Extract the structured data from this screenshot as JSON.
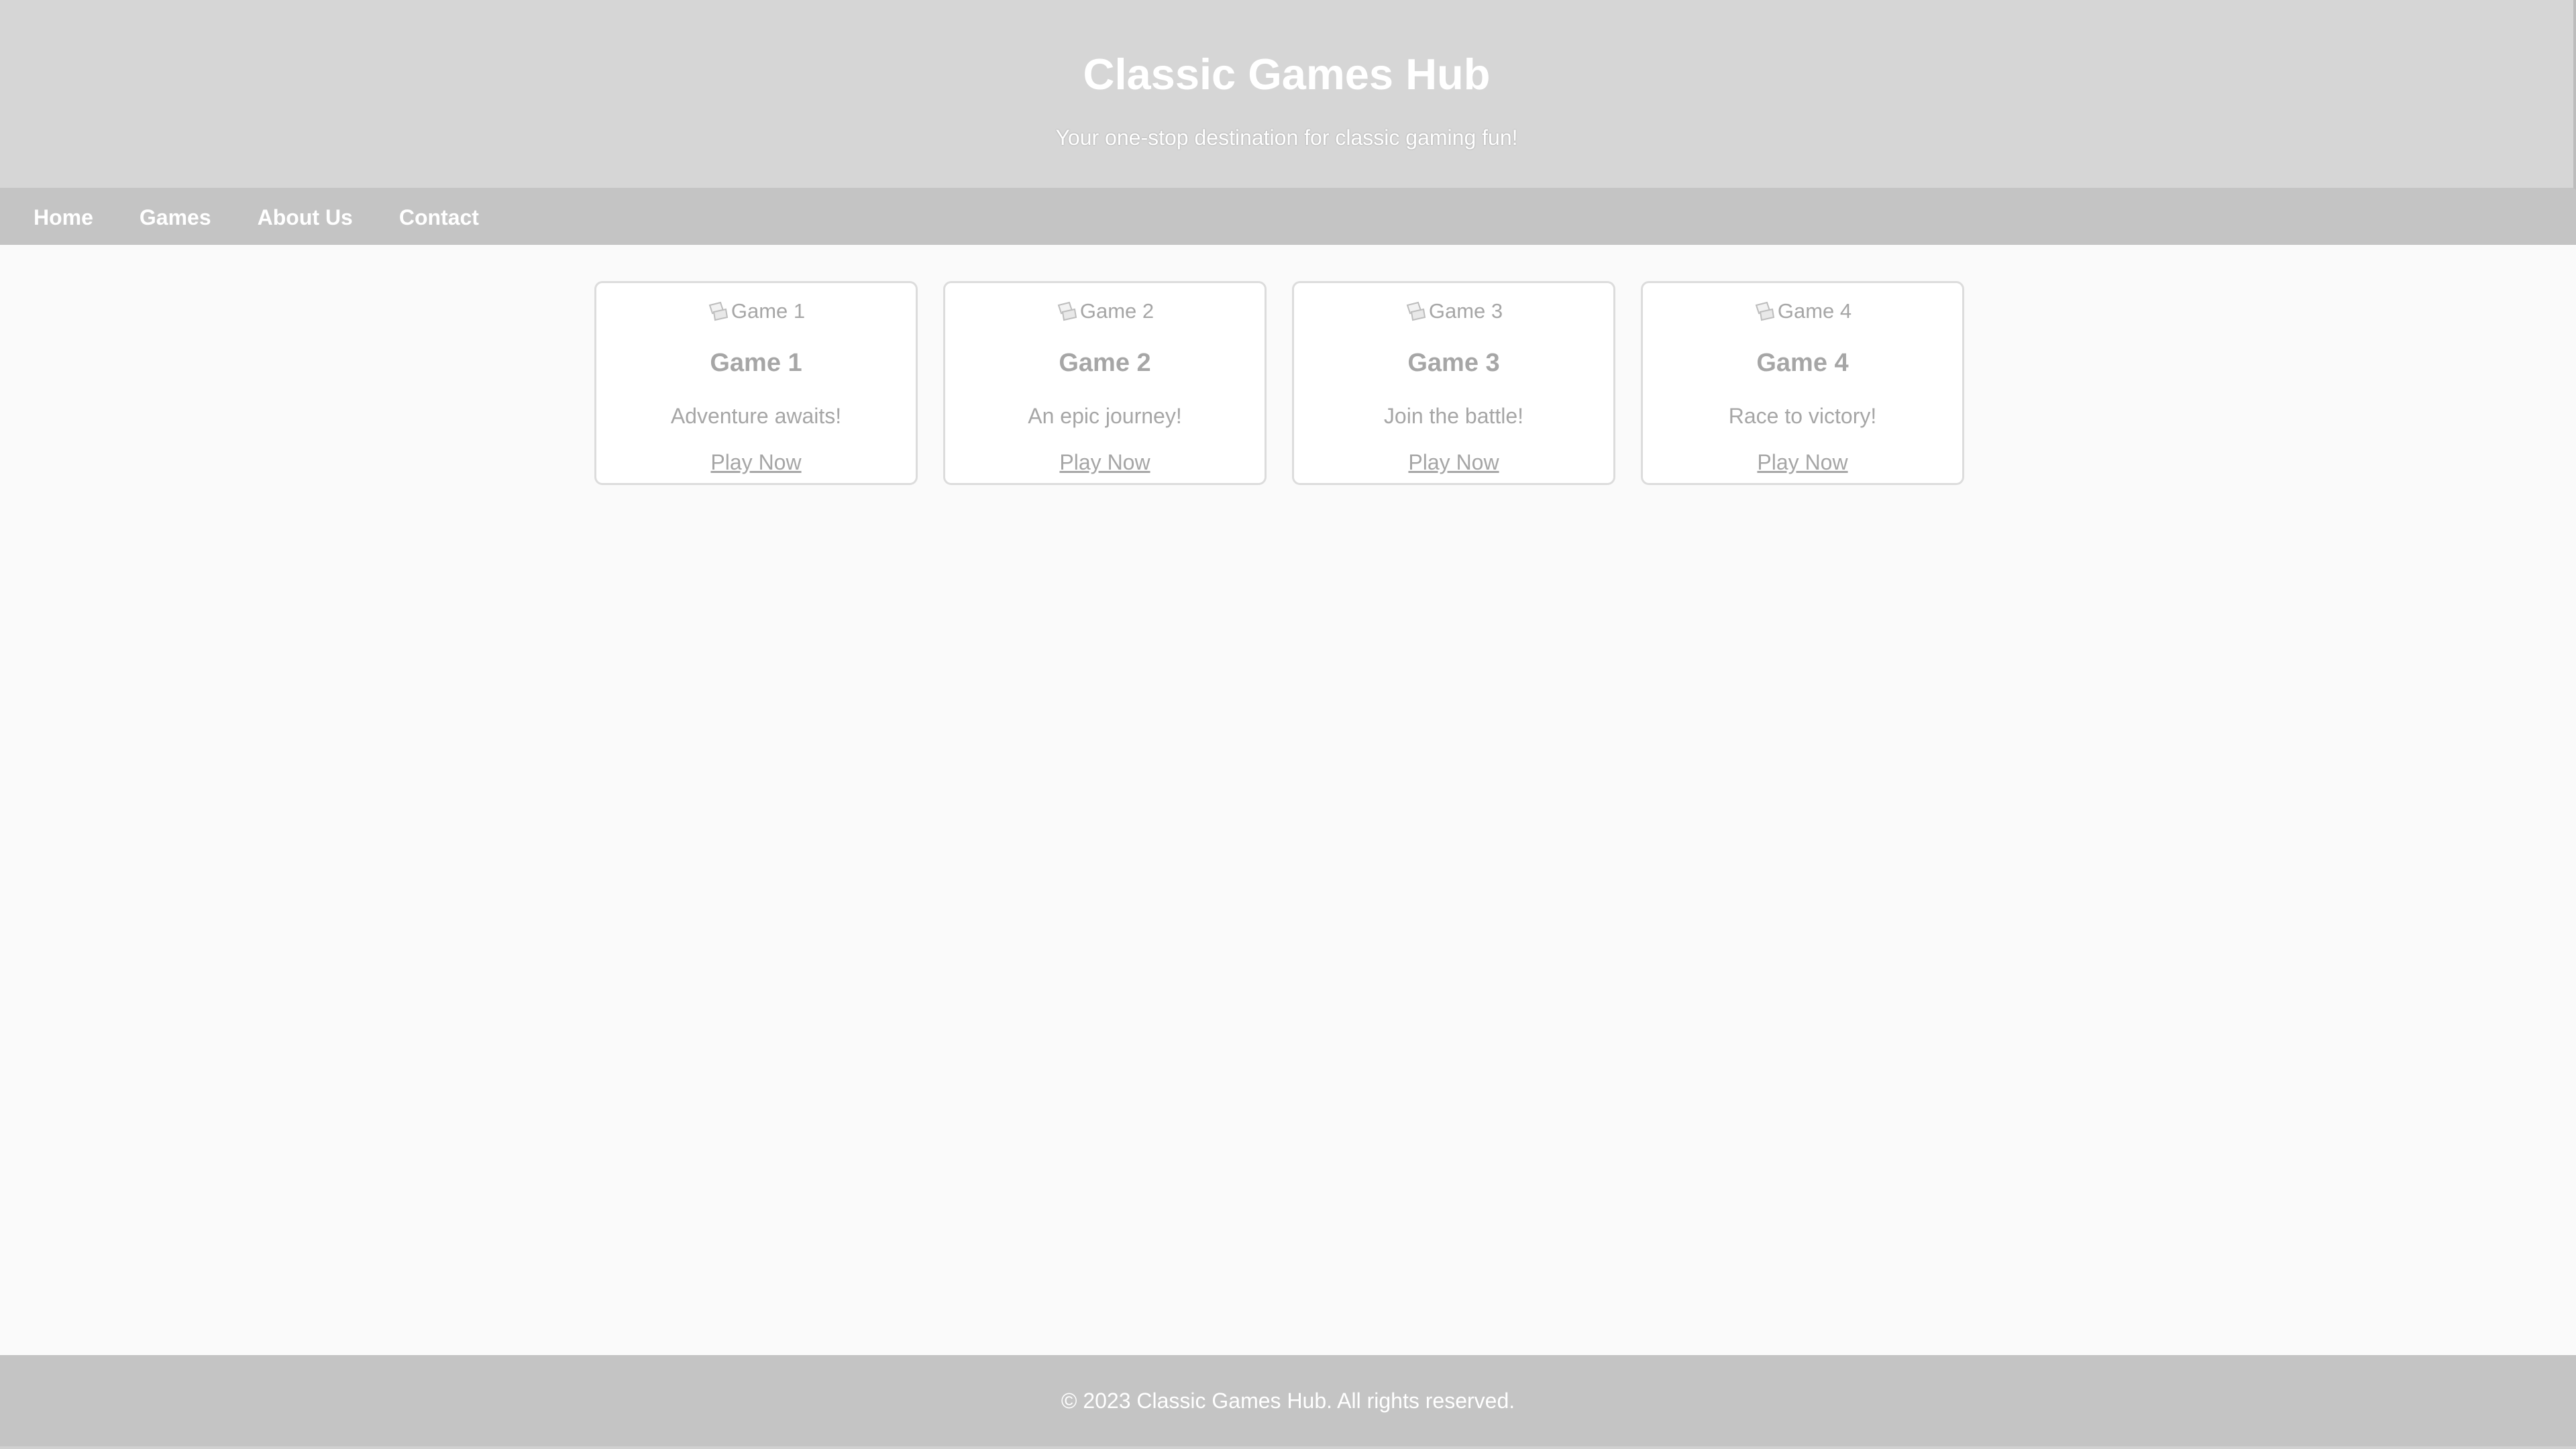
{
  "header": {
    "title": "Classic Games Hub",
    "tagline": "Your one-stop destination for classic gaming fun!"
  },
  "nav": {
    "items": [
      {
        "label": "Home"
      },
      {
        "label": "Games"
      },
      {
        "label": "About Us"
      },
      {
        "label": "Contact"
      }
    ]
  },
  "games": [
    {
      "img_alt": "Game 1",
      "title": "Game 1",
      "description": "Adventure awaits!",
      "link_label": "Play Now"
    },
    {
      "img_alt": "Game 2",
      "title": "Game 2",
      "description": "An epic journey!",
      "link_label": "Play Now"
    },
    {
      "img_alt": "Game 3",
      "title": "Game 3",
      "description": "Join the battle!",
      "link_label": "Play Now"
    },
    {
      "img_alt": "Game 4",
      "title": "Game 4",
      "description": "Race to victory!",
      "link_label": "Play Now"
    }
  ],
  "footer": {
    "text": "© 2023 Classic Games Hub. All rights reserved."
  },
  "colors": {
    "header_bg": "#d6d6d6",
    "nav_bg": "#c4c4c4",
    "page_bg": "#fafafa",
    "card_text": "#a6a6a6",
    "footer_bg": "#c4c4c4"
  },
  "icons": {
    "broken_image": "broken-image-icon"
  }
}
